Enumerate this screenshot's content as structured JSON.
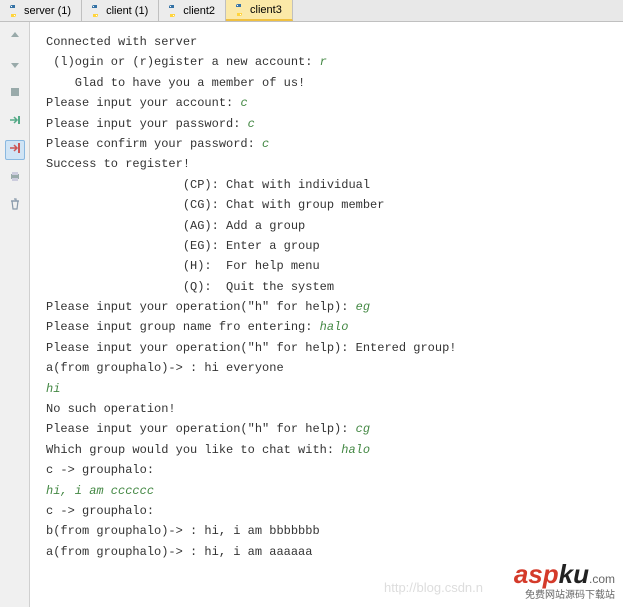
{
  "tabs": [
    {
      "label": "server (1)",
      "active": false
    },
    {
      "label": "client (1)",
      "active": false
    },
    {
      "label": "client2",
      "active": false
    },
    {
      "label": "client3",
      "active": true
    }
  ],
  "sidebar_icons": [
    "up-icon",
    "down-icon",
    "stop-icon",
    "run-to-icon",
    "exit-icon",
    "print-icon",
    "trash-icon"
  ],
  "console": {
    "lines": [
      {
        "t": "Connected with server",
        "i": ""
      },
      {
        "t": " (l)ogin or (r)egister a new account: ",
        "i": "r"
      },
      {
        "t": "",
        "i": ""
      },
      {
        "t": "    Glad to have you a member of us!",
        "i": ""
      },
      {
        "t": "",
        "i": ""
      },
      {
        "t": "Please input your account: ",
        "i": "c"
      },
      {
        "t": "Please input your password: ",
        "i": "c"
      },
      {
        "t": "Please confirm your password: ",
        "i": "c"
      },
      {
        "t": "Success to register!",
        "i": ""
      },
      {
        "t": "",
        "i": ""
      },
      {
        "t": "                   (CP): Chat with individual",
        "i": ""
      },
      {
        "t": "                   (CG): Chat with group member",
        "i": ""
      },
      {
        "t": "                   (AG): Add a group",
        "i": ""
      },
      {
        "t": "                   (EG): Enter a group",
        "i": ""
      },
      {
        "t": "                   (H):  For help menu",
        "i": ""
      },
      {
        "t": "                   (Q):  Quit the system",
        "i": ""
      },
      {
        "t": "",
        "i": ""
      },
      {
        "t": "Please input your operation(\"h\" for help): ",
        "i": "eg"
      },
      {
        "t": "Please input group name fro entering: ",
        "i": "halo"
      },
      {
        "t": "Please input your operation(\"h\" for help): Entered group!",
        "i": ""
      },
      {
        "t": "a(from grouphalo)-> : hi everyone",
        "i": ""
      },
      {
        "t": "",
        "i": "hi"
      },
      {
        "t": "No such operation!",
        "i": ""
      },
      {
        "t": "Please input your operation(\"h\" for help): ",
        "i": "cg"
      },
      {
        "t": "Which group would you like to chat with: ",
        "i": "halo"
      },
      {
        "t": "c -> grouphalo:",
        "i": ""
      },
      {
        "t": "",
        "i": "hi, i am cccccc"
      },
      {
        "t": "c -> grouphalo:",
        "i": ""
      },
      {
        "t": "b(from grouphalo)-> : hi, i am bbbbbbb",
        "i": ""
      },
      {
        "t": "a(from grouphalo)-> : hi, i am aaaaaa",
        "i": ""
      }
    ]
  },
  "watermark": {
    "blog": "http://blog.csdn.n",
    "logo_asp": "asp",
    "logo_ku": "ku",
    "logo_com": ".com",
    "logo_sub": "免费网站源码下载站"
  }
}
